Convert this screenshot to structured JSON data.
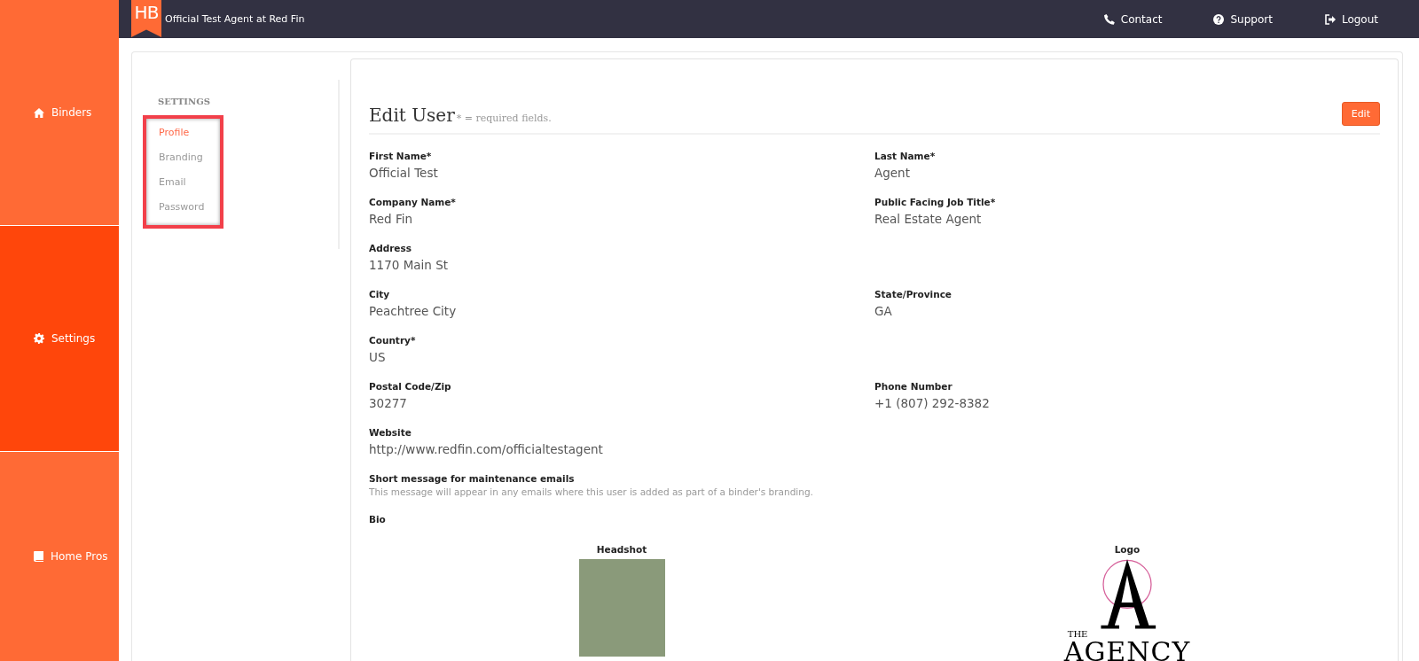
{
  "sidebar": {
    "items": [
      {
        "label": "Binders",
        "selected": false
      },
      {
        "label": "Settings",
        "selected": true
      },
      {
        "label": "Home Pros",
        "selected": false
      }
    ]
  },
  "top_bar": {
    "logo": "HB",
    "title": "Official Test Agent at Red Fin",
    "links": [
      {
        "label": "Contact"
      },
      {
        "label": "Support"
      },
      {
        "label": "Logout"
      }
    ]
  },
  "settings_nav": {
    "heading": "SETTINGS",
    "highlighted": true,
    "items": [
      {
        "label": "Profile",
        "selected": true
      },
      {
        "label": "Branding",
        "selected": false
      },
      {
        "label": "Email",
        "selected": false
      },
      {
        "label": "Password",
        "selected": false
      }
    ]
  },
  "form": {
    "title": "Edit User",
    "note": "* = required fields.",
    "edit_button": "Edit",
    "rows": [
      [
        {
          "label": "First Name*",
          "value": "Official Test"
        },
        {
          "label": "Last Name*",
          "value": "Agent"
        }
      ],
      [
        {
          "label": "Company Name*",
          "value": "Red Fin"
        },
        {
          "label": "Public Facing Job Title*",
          "value": "Real Estate Agent"
        }
      ],
      [
        {
          "label": "Address",
          "value": "1170 Main St"
        }
      ],
      [
        {
          "label": "City",
          "value": "Peachtree City"
        },
        {
          "label": "State/Province",
          "value": "GA"
        }
      ],
      [
        {
          "label": "Country*",
          "value": "US"
        }
      ],
      [
        {
          "label": "Postal Code/Zip",
          "value": "30277"
        },
        {
          "label": "Phone Number",
          "value": "+1 (807) 292-8382"
        }
      ],
      [
        {
          "label": "Website",
          "value": "http://www.redfin.com/officialtestagent"
        }
      ]
    ],
    "message": {
      "label": "Short message for maintenance emails",
      "hint": "This message will appear in any emails where this user is added as part of a binder's branding."
    },
    "bio": {
      "label": "Bio"
    },
    "headshot": {
      "label": "Headshot"
    },
    "logo": {
      "label": "Logo",
      "small": "THE",
      "big": "AGENCY"
    }
  }
}
